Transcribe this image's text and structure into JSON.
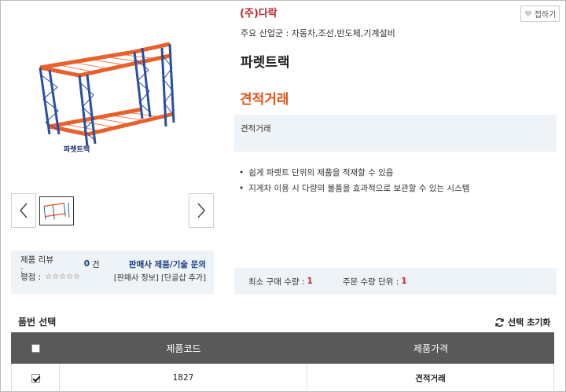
{
  "header": {
    "company": "(주)다락",
    "fold_label": "접하기",
    "industry_label": "주요 산업군 :",
    "industry_value": "자동차,조선,반도체,기계설비"
  },
  "product": {
    "title": "파렛트랙",
    "price": "견적거래",
    "description": "견적거래",
    "image_caption": "파렛트랙",
    "features": [
      "쉽게 파렛트 단위의 제품을 적재할 수 있음",
      "지게차 이용 시 다량의 물품을 효과적으로 보관할 수 있는 시스템"
    ]
  },
  "review": {
    "label": "제품 리뷰 :",
    "count": "0",
    "unit": "건",
    "inquiry_link": "판매사 제품/기술 문의",
    "rating_label": "평점 :",
    "stars": "☆☆☆☆☆",
    "seller_info": "[판매사 정보]",
    "add_favorite": "[단골샵 추가]"
  },
  "quantity": {
    "min_label": "최소 구매 수량 :",
    "min_value": "1",
    "unit_label": "주문 수량 단위 :",
    "unit_value": "1"
  },
  "options": {
    "title": "품번 선택",
    "reset_label": "선택 초기화",
    "headers": {
      "code": "제품코드",
      "price": "제품가격"
    },
    "rows": [
      {
        "code": "1827",
        "price": "견적거래",
        "checked": true
      }
    ]
  },
  "colors": {
    "company": "#c0282d",
    "price": "#e0541d",
    "rack_orange": "#e8612c",
    "rack_blue": "#2a4f9e",
    "info_bg": "#eef3f7",
    "table_header": "#595959"
  }
}
